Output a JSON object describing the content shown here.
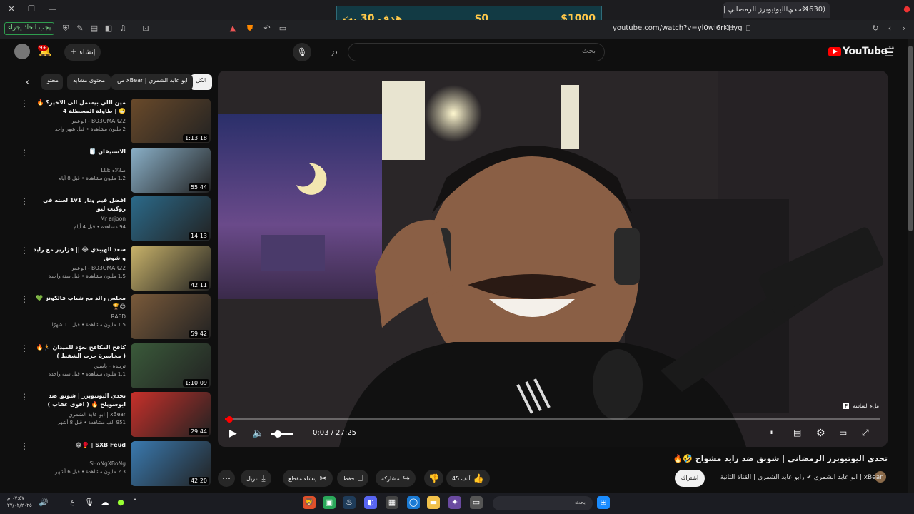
{
  "browser": {
    "tab_title": "(630) تحدي اليوتيوبرز الرمضاني | ﺷ",
    "url": "youtube.com/watch?v=yl0wi6rKHyg",
    "task_button": "يجب اتخاذ إجراء"
  },
  "donation_overlay": {
    "goal": "هدف 30 بث",
    "current": "$0",
    "target": "$1000"
  },
  "header": {
    "search_placeholder": "بحث",
    "create_label": "إنشاء",
    "notifications_badge": "9+",
    "logo_text": "YouTube",
    "logo_region": "SA"
  },
  "chips": [
    "الكل",
    "من xBear | ابو عابد الشمري",
    "محتوى مشابه",
    "محتو"
  ],
  "sidebar_videos": [
    {
      "title": "مين اللي بيسمل الى الاخير؟ 🔥😬 | طاولة المسطلة 4",
      "channel": "BO3OMAR22 - ابوعمر",
      "meta": "2 مليون مشاهدة • قبل شهر واحد",
      "duration": "1:13:18",
      "color": "#6a4a2a"
    },
    {
      "title": "الاستيقان 🧻",
      "channel": "صلالاه LLE",
      "meta": "1.2 مليون مشاهدة • قبل 8 أيام",
      "duration": "55:44",
      "color": "#8ab0c8"
    },
    {
      "title": "افضل فيم ونار 1v1 لعبته في روكيت ليق",
      "channel": "Mr arjoon",
      "meta": "94 مشاهدة • قبل 4 أيام",
      "duration": "14:13",
      "color": "#2b6a8a"
    },
    {
      "title": "سعد الهيبدي 😂 || فزارير مع رايد و شونق",
      "channel": "BO3OMAR22 - ابوعمر",
      "meta": "1.5 مليون مشاهدة • قبل سنة واحدة",
      "duration": "42:11",
      "color": "#c9b36a"
    },
    {
      "title": "مجلس رائد مع شباب فالكونز 💚😍🏆",
      "channel": "RAED",
      "meta": "1.5 مليون مشاهدة • قبل 11 شهرًا",
      "duration": "59:42",
      "color": "#7a5a3a"
    },
    {
      "title": "كافح المكافح بعوّد للميدان 🏃🔥 ( مخاسرة حزب الشفط )",
      "channel": "تربيدة - ياسين",
      "meta": "1.1 مليون مشاهدة • قبل سنة واحدة",
      "duration": "1:10:09",
      "color": "#3a5a3a"
    },
    {
      "title": "تحدي اليوتيوبرز | شونق ضد ابوسويلح 🔥 ( اقوى عقاب )",
      "channel": "xBear | ابو عابد الشمري",
      "meta": "951 ألف مشاهدة • قبل 8 أشهر",
      "duration": "29:44",
      "color": "#c8302a"
    },
    {
      "title": "SXB Feud | 🥊😂",
      "channel": "SHoNgXBoNg",
      "meta": "2.3 مليون مشاهدة • قبل 6 أشهر",
      "duration": "42:20",
      "color": "#3a7ab0"
    }
  ],
  "player": {
    "time_current": "0:03",
    "time_total": "27:25",
    "time_display": "0:03 / 27:25",
    "progress_fraction": 0.002,
    "volume_fraction": 0.3,
    "fullscreen_hint": "ملء الشاشة",
    "fullscreen_key": "F"
  },
  "video": {
    "title": "تحدي اليوتيوبرز الرمضاني | شونق ضد رايد مشواح 🤣🔥",
    "channel_line": "xBear | ابو عابد الشمري ✔ رابو عابد الشمري | القناة الثانية",
    "subscribe_label": "اشتراك",
    "likes": "45 ألف",
    "share_label": "مشاركة",
    "save_label": "حفظ",
    "clip_label": "إنشاء مقطع",
    "download_label": "تنزيل"
  },
  "taskbar": {
    "search_placeholder": "بحث",
    "time": "٠٧:٤٧ م",
    "date": "٢٧/٠٢/٢٠٢٥",
    "lang": "ع"
  },
  "colors": {
    "yt_red": "#ff0000",
    "background": "#0f0f0f",
    "chip_bg": "#272727",
    "donation_bg": "#123a44"
  }
}
